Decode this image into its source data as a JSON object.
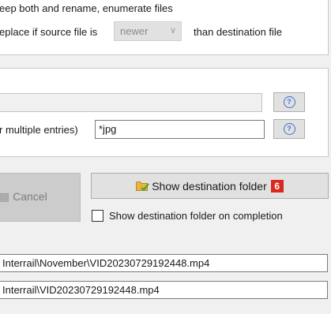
{
  "options": {
    "keep_both_label": "eep both and rename, enumerate files",
    "replace_label": "eplace if source file is",
    "replace_condition": "newer",
    "replace_suffix": "than destination file"
  },
  "filters": {
    "multiple_entries_label": "r multiple entries)",
    "filter_value": "*jpg",
    "help_glyph": "?"
  },
  "actions": {
    "cancel_label": "Cancel",
    "show_destination_label": "Show destination folder",
    "show_destination_badge": "6",
    "show_on_completion_label": "Show destination folder on completion",
    "show_on_completion_checked": false
  },
  "paths": {
    "destination_path": "Interrail\\November\\VID20230729192448.mp4",
    "source_path": "Interrail\\VID20230729192448.mp4"
  },
  "colors": {
    "badge": "#d9281e",
    "help_icon": "#3d6fd1"
  }
}
